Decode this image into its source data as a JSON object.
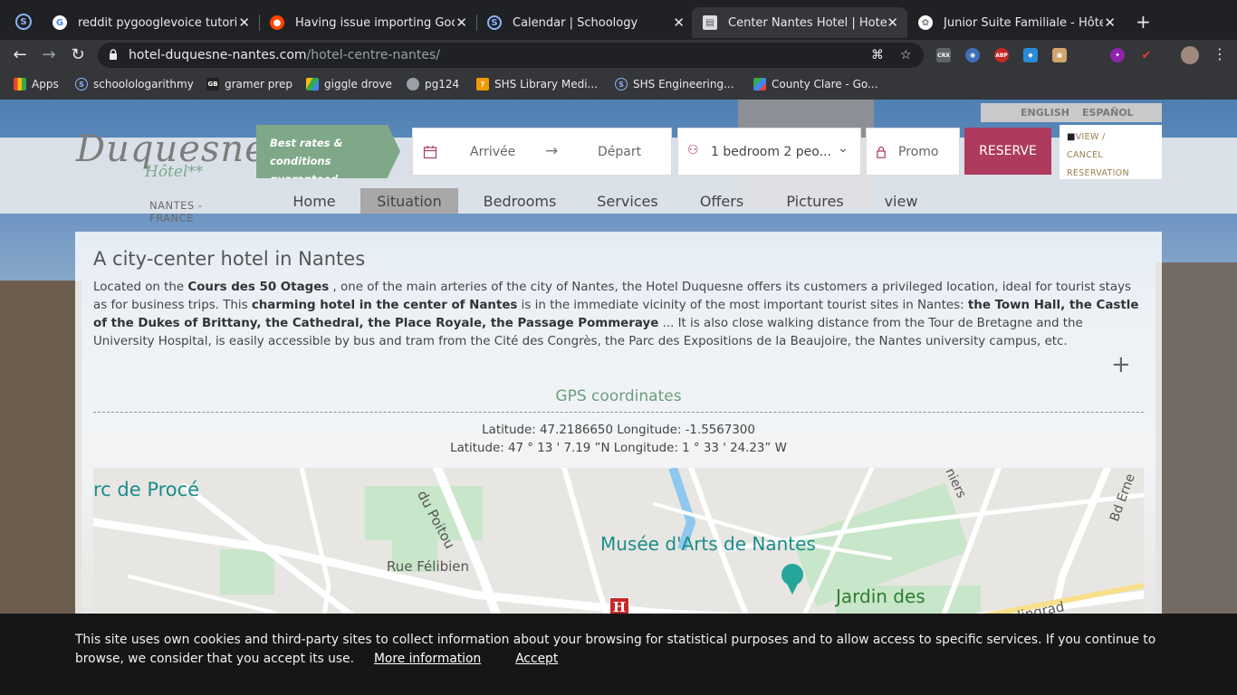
{
  "browser": {
    "tabs": [
      {
        "title": "reddit pygooglevoice tutorial -",
        "icon": "google-icon",
        "active": false
      },
      {
        "title": "Having issue importing Google",
        "icon": "reddit-icon",
        "active": false
      },
      {
        "title": "Calendar | Schoology",
        "icon": "schoology-icon",
        "active": false
      },
      {
        "title": "Center Nantes Hotel | Hotel Du",
        "icon": "page-icon",
        "active": true
      },
      {
        "title": "Junior Suite Familiale - Hôtel L",
        "icon": "flower-icon",
        "active": false
      }
    ],
    "url_host": "hotel-duquesne-nantes.com",
    "url_path": "/hotel-centre-nantes/",
    "bookmarks": [
      {
        "label": "Apps",
        "icon": "apps-grid-icon"
      },
      {
        "label": "schoolologarithmy",
        "icon": "schoology-icon"
      },
      {
        "label": "gramer prep",
        "icon": "gb-icon"
      },
      {
        "label": "giggle drove",
        "icon": "drive-icon"
      },
      {
        "label": "pg124",
        "icon": "globe-icon"
      },
      {
        "label": "SHS Library Medi...",
        "icon": "library-icon"
      },
      {
        "label": "SHS Engineering...",
        "icon": "schoology-icon"
      },
      {
        "label": "County Clare - Go...",
        "icon": "maps-icon"
      }
    ],
    "extensions": [
      "CRX",
      "ABP"
    ]
  },
  "site": {
    "languages": [
      "ENGLISH",
      "ESPAÑOL"
    ],
    "logo_script": "Duquesne",
    "logo_hotel": "Hôtel**",
    "logo_city": "NANTES - FRANCE",
    "promo_text": "Best rates & conditions guaranteed",
    "booking": {
      "arrival": "Arrivée",
      "departure": "Départ",
      "guests": "1 bedroom 2 peo...",
      "promo": "Promo",
      "reserve": "RESERVE",
      "view_cancel": "VIEW / CANCEL RESERVATION",
      "view_cancel_l1": "VIEW /",
      "view_cancel_l2": "CANCEL",
      "view_cancel_l3": "RESERVATION"
    },
    "menu": [
      "Home",
      "Situation",
      "Bedrooms",
      "Services",
      "Offers",
      "Pictures",
      "view"
    ],
    "menu_active": "Situation"
  },
  "content": {
    "title": "A city-center hotel in Nantes",
    "intro": [
      {
        "t": "Located on the "
      },
      {
        "t": "Cours des 50 Otages",
        "b": true
      },
      {
        "t": " , one of the main arteries of the city of Nantes, the Hotel Duquesne offers its customers a privileged location, ideal for tourist stays as for business trips. This "
      },
      {
        "t": "charming hotel in the center of Nantes",
        "b": true
      },
      {
        "t": " is in the immediate vicinity of the most important tourist sites in Nantes: "
      },
      {
        "t": "the Town Hall, the Castle of the Dukes of Brittany, the Cathedral, the Place Royale, the Passage Pommeraye",
        "b": true
      },
      {
        "t": " ... It is also close walking distance from the Tour de Bretagne and the University Hospital, is easily accessible by bus and tram from the Cité des Congrès, the Parc des Expositions de la Beaujoire, the Nantes university campus, etc."
      }
    ],
    "gps_title": "GPS coordinates",
    "gps_decimal": "Latitude: 47.2186650 Longitude: -1.5567300",
    "gps_dms": "Latitude: 47 ° 13 ' 7.19 ”N Longitude: 1 ° 33 ' 24.23” W",
    "map_labels": [
      "rc de Procé",
      "du Poitou",
      "Musée d'Arts de Nantes",
      "Rue Félibien",
      "Jardin des",
      "Stalingrad",
      "niers",
      "Bd Erne"
    ],
    "map_marker": "H"
  },
  "cookie": {
    "text": "This site uses own cookies and third-party sites to collect information about your browsing for statistical purposes and to allow access to specific services. If you continue to browse, we consider that you accept its use.",
    "more": "More information",
    "accept": "Accept"
  },
  "colors": {
    "brand_green": "#7fa889",
    "reserve": "#ae3a5e",
    "gps_title": "#6b9e7f",
    "map_teal": "#1a8c8c"
  }
}
